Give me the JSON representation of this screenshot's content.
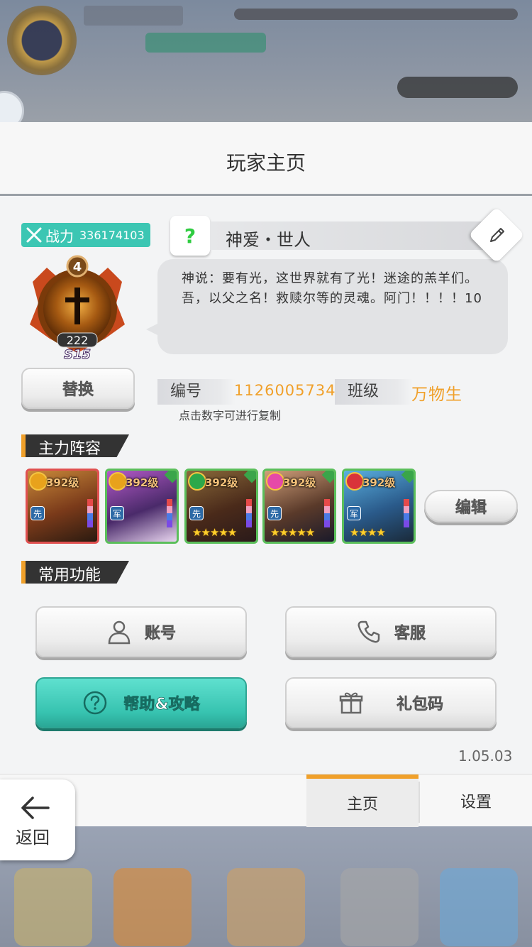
{
  "dialog": {
    "title": "玩家主页"
  },
  "profile": {
    "power_label": "战力",
    "power_value": "336174103",
    "medal_level": "4",
    "medal_count": "222",
    "medal_season": "S15",
    "name_prefix": "?",
    "name": "神爱・世人",
    "bio": "神说：要有光，这世界就有了光！迷途的羔羊们。吾，以父之名！救赎尔等的灵魂。阿门！！！！10",
    "replace_button": "替换",
    "id_label": "编号",
    "id_value": "1126005734",
    "class_label": "班级",
    "class_value": "万物生",
    "copy_hint": "点击数字可进行复制"
  },
  "lineup": {
    "section_title": "主力阵容",
    "edit_button": "编辑",
    "heroes": [
      {
        "level": "392级",
        "role": "先",
        "stars": "",
        "frame": "red",
        "badge_color": "#e8a21c"
      },
      {
        "level": "392级",
        "role": "军",
        "stars": "",
        "frame": "green",
        "badge_color": "#e8a21c"
      },
      {
        "level": "392级",
        "role": "先",
        "stars": "★★★★★",
        "frame": "green",
        "badge_color": "#2da84a"
      },
      {
        "level": "392级",
        "role": "先",
        "stars": "★★★★★",
        "frame": "green",
        "badge_color": "#e64aa8"
      },
      {
        "level": "392级",
        "role": "军",
        "stars": "★★★★",
        "frame": "green",
        "badge_color": "#d9333a"
      }
    ]
  },
  "functions": {
    "section_title": "常用功能",
    "account": "账号",
    "service": "客服",
    "help": "帮助&攻略",
    "gift_code": "礼包码"
  },
  "version": "1.05.03",
  "tabs": {
    "home": "主页",
    "settings": "设置"
  },
  "back": {
    "label": "返回"
  },
  "colors": {
    "accent": "#f0a02a",
    "teal": "#3cc6b3",
    "id_value": "#f0a02a"
  }
}
